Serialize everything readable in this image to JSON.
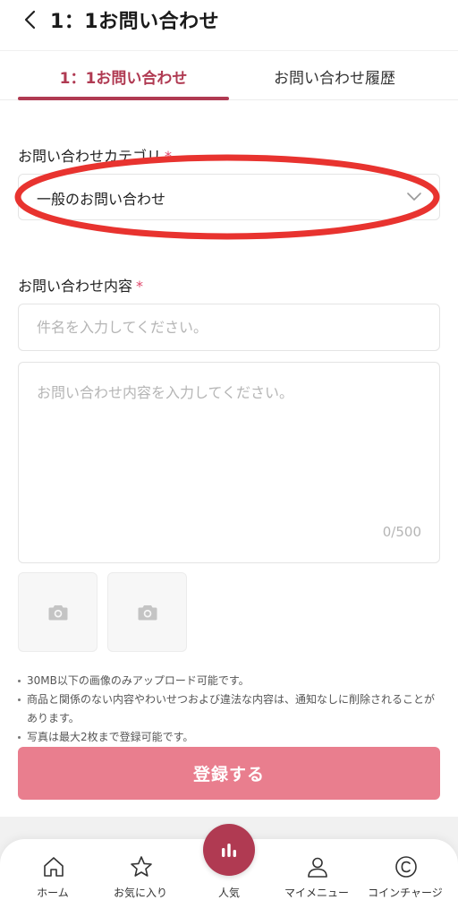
{
  "header": {
    "title": "1：1お問い合わせ",
    "back_icon": "chevron-left-icon"
  },
  "tabs": [
    {
      "label": "1：1お問い合わせ",
      "active": true
    },
    {
      "label": "お問い合わせ履歴",
      "active": false
    }
  ],
  "form": {
    "category_label": "お問い合わせカテゴリ",
    "category_required": "*",
    "category_value": "一般のお問い合わせ",
    "content_label": "お問い合わせ内容",
    "content_required": "*",
    "subject_placeholder": "件名を入力してください。",
    "body_placeholder": "お問い合わせ内容を入力してください。",
    "char_count": "0/500"
  },
  "photos": {
    "slot_count": 2,
    "icon": "camera-icon"
  },
  "notes": [
    "30MB以下の画像のみアップロード可能です。",
    "商品と関係のない内容やわいせつおよび違法な内容は、通知なしに削除されることがあります。",
    "写真は最大2枚まで登録可能です。"
  ],
  "submit_label": "登録する",
  "nav": {
    "home": "ホーム",
    "favorites": "お気に入り",
    "popular": "人気",
    "mymenu": "マイメニュー",
    "coin": "コインチャージ"
  },
  "colors": {
    "accent": "#b03a52",
    "submit": "#e97e8e",
    "required": "#e0476a",
    "highlight": "#e8332f"
  }
}
